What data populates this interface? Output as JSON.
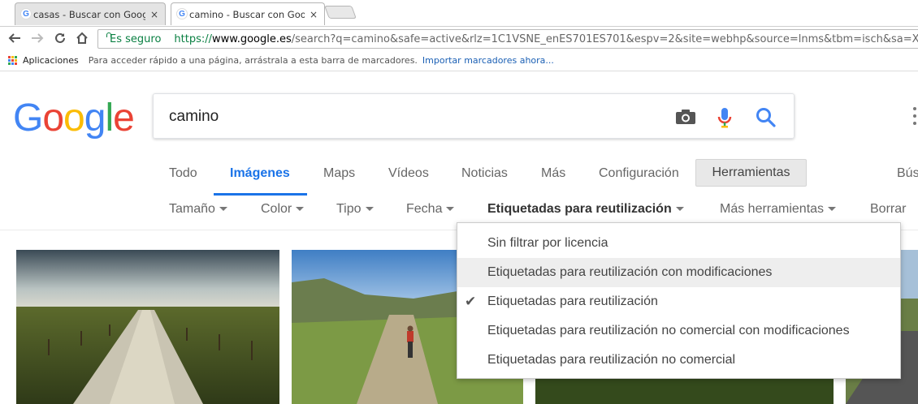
{
  "browser": {
    "tabs": [
      {
        "title": "casas - Buscar con Google",
        "close": "×"
      },
      {
        "title": "camino - Buscar con Google",
        "close": "×"
      }
    ],
    "favicon": "G",
    "secure_label": "Es seguro",
    "url_scheme": "https://",
    "url_host": "www.google.es",
    "url_rest": "/search?q=camino&safe=active&rlz=1C1VSNE_enES701ES701&espv=2&site=webhp&source=lnms&tbm=isch&sa=X&ved=",
    "bookmarks": {
      "apps_label": "Aplicaciones",
      "hint": "Para acceder rápido a una página, arrástrala a esta barra de marcadores.",
      "import_link": "Importar marcadores ahora..."
    },
    "icons": {
      "back": "back-arrow-icon",
      "forward": "forward-arrow-icon",
      "reload": "reload-icon",
      "home": "home-icon",
      "lock": "lock-icon",
      "apps": "apps-grid-icon"
    }
  },
  "google": {
    "logo": [
      "G",
      "o",
      "o",
      "g",
      "l",
      "e"
    ],
    "logo_colors": [
      "#4285F4",
      "#EA4335",
      "#FBBC05",
      "#4285F4",
      "#34A853",
      "#EA4335"
    ],
    "search_value": "camino",
    "tabs": [
      "Todo",
      "Imágenes",
      "Maps",
      "Vídeos",
      "Noticias",
      "Más",
      "Configuración",
      "Herramientas",
      "Bús"
    ],
    "active_tab": "Imágenes",
    "tools": [
      "Tamaño",
      "Color",
      "Tipo",
      "Fecha",
      "Etiquetadas para reutilización",
      "Más herramientas",
      "Borrar"
    ],
    "license_menu": {
      "options": [
        {
          "label": "Sin filtrar por licencia",
          "checked": false,
          "highlighted": false
        },
        {
          "label": "Etiquetadas para reutilización con modificaciones",
          "checked": false,
          "highlighted": true
        },
        {
          "label": "Etiquetadas para reutilización",
          "checked": true,
          "highlighted": false
        },
        {
          "label": "Etiquetadas para reutilización no comercial con modificaciones",
          "checked": false,
          "highlighted": false
        },
        {
          "label": "Etiquetadas para reutilización no comercial",
          "checked": false,
          "highlighted": false
        }
      ],
      "check_glyph": "✔"
    }
  },
  "colors": {
    "link_blue": "#1a73e8",
    "secure_green": "#0b8043"
  }
}
